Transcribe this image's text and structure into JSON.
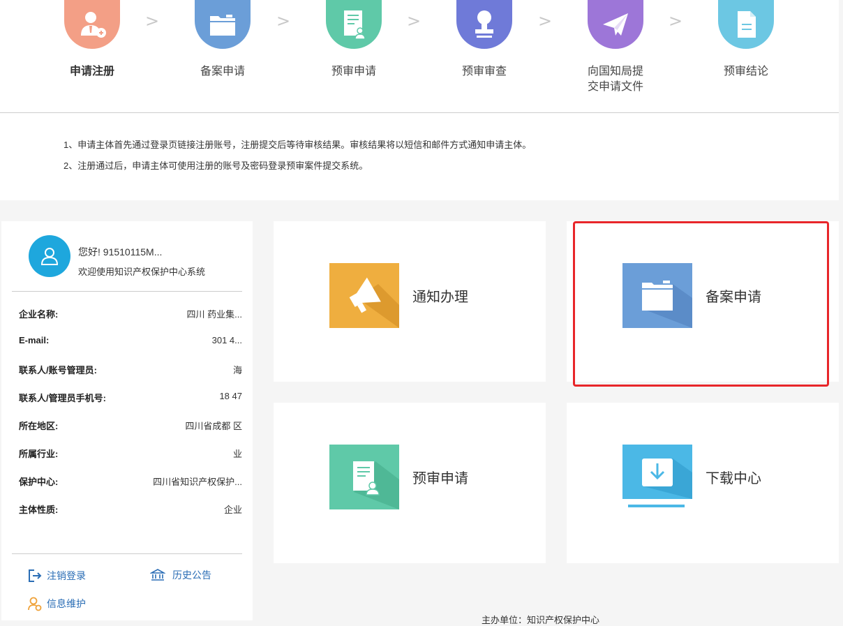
{
  "steps": [
    {
      "label": "申请注册",
      "color": "#f39f86",
      "icon": "user-add-icon"
    },
    {
      "label": "备案申请",
      "color": "#6b9ed8",
      "icon": "folder-icon"
    },
    {
      "label": "预审申请",
      "color": "#5fc9a8",
      "icon": "document-user-icon"
    },
    {
      "label": "预审审查",
      "color": "#6f7ad8",
      "icon": "stamp-icon"
    },
    {
      "label": "向国知局提交申请文件",
      "color": "#9d76d8",
      "icon": "paper-plane-icon"
    },
    {
      "label": "预审结论",
      "color": "#6cc7e3",
      "icon": "file-icon"
    }
  ],
  "step_separator": ">",
  "notes": [
    "1、申请主体首先通过登录页链接注册账号，注册提交后等待审核结果。审核结果将以短信和邮件方式通知申请主体。",
    "2、注册通过后，申请主体可使用注册的账号及密码登录预审案件提交系统。"
  ],
  "user": {
    "hello": "您好! 91510115M...",
    "welcome": "欢迎使用知识产权保护中心系统",
    "fields": [
      {
        "key": "企业名称:",
        "value": "四川 药业集..."
      },
      {
        "key": "E-mail:",
        "value": "301 4..."
      },
      {
        "key": "联系人/账号管理员:",
        "value": "海"
      },
      {
        "key": "联系人/管理员手机号:",
        "value": "18 47"
      },
      {
        "key": "所在地区:",
        "value": "四川省成都 区"
      },
      {
        "key": "所属行业:",
        "value": "业"
      },
      {
        "key": "保护中心:",
        "value": "四川省知识产权保护..."
      },
      {
        "key": "主体性质:",
        "value": "企业"
      }
    ],
    "links": {
      "logout": "注销登录",
      "history": "历史公告",
      "info": "信息维护"
    }
  },
  "tiles": [
    {
      "label": "通知办理",
      "color": "#efae3f",
      "icon": "megaphone-icon"
    },
    {
      "label": "备案申请",
      "color": "#6b9ed8",
      "icon": "folder-icon"
    },
    {
      "label": "预审申请",
      "color": "#5fc9a8",
      "icon": "document-user-icon"
    },
    {
      "label": "下载中心",
      "color": "#4bb8e6",
      "icon": "download-icon"
    }
  ],
  "footer": "主办单位：知识产权保护中心"
}
